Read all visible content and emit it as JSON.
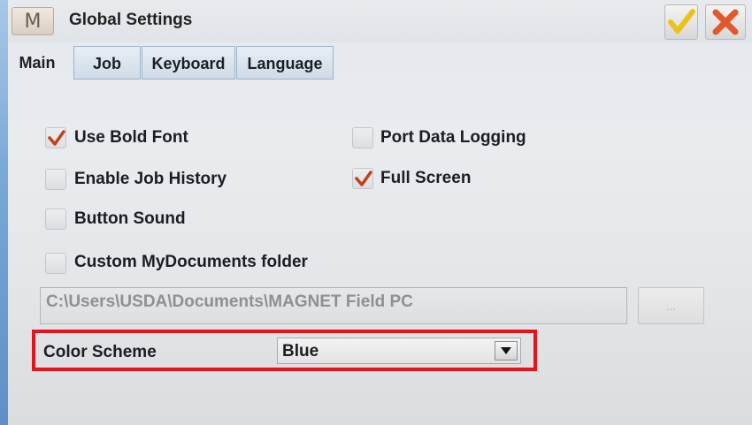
{
  "window": {
    "title": "Global Settings",
    "logo_text": "M"
  },
  "tabs": [
    {
      "label": "Main",
      "selected": true
    },
    {
      "label": "Job",
      "selected": false
    },
    {
      "label": "Keyboard",
      "selected": false
    },
    {
      "label": "Language",
      "selected": false
    }
  ],
  "options": {
    "use_bold_font": {
      "label": "Use Bold Font",
      "checked": true
    },
    "port_data_logging": {
      "label": "Port Data Logging",
      "checked": false
    },
    "enable_job_history": {
      "label": "Enable Job History",
      "checked": false
    },
    "full_screen": {
      "label": "Full Screen",
      "checked": true
    },
    "button_sound": {
      "label": "Button Sound",
      "checked": false
    },
    "custom_mydocuments_folder": {
      "label": "Custom MyDocuments folder",
      "checked": false
    }
  },
  "documents_path": {
    "value": "C:\\Users\\USDA\\Documents\\MAGNET Field PC"
  },
  "browse_button": {
    "label": "..."
  },
  "color_scheme": {
    "label": "Color Scheme",
    "selected": "Blue"
  },
  "colors": {
    "highlight": "#e3141c",
    "check": "#c0411c",
    "ok": "#e8c419",
    "close": "#e2572b",
    "accent_edge": "#6e9fd2"
  }
}
